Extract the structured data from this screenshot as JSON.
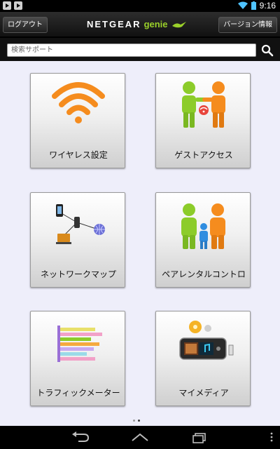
{
  "status": {
    "time": "9:16"
  },
  "header": {
    "logout_label": "ログアウト",
    "version_label": "バージョン情報",
    "brand": "NETGEAR",
    "brand_suffix": "genie"
  },
  "search": {
    "placeholder": "検索サポート"
  },
  "tiles": [
    {
      "label": "ワイヤレス設定",
      "icon": "wifi-icon"
    },
    {
      "label": "ゲストアクセス",
      "icon": "guest-access-icon"
    },
    {
      "label": "ネットワークマップ",
      "icon": "network-map-icon"
    },
    {
      "label": "ペアレンタルコントロ",
      "icon": "parental-control-icon"
    },
    {
      "label": "トラフィックメーター",
      "icon": "traffic-meter-icon"
    },
    {
      "label": "マイメディア",
      "icon": "my-media-icon"
    }
  ],
  "pager": {
    "pages": 2,
    "current": 2
  },
  "colors": {
    "accent": "#f58c1e",
    "green": "#8ccc2a",
    "blue": "#2f8de0",
    "main_bg": "#eeeefa"
  }
}
